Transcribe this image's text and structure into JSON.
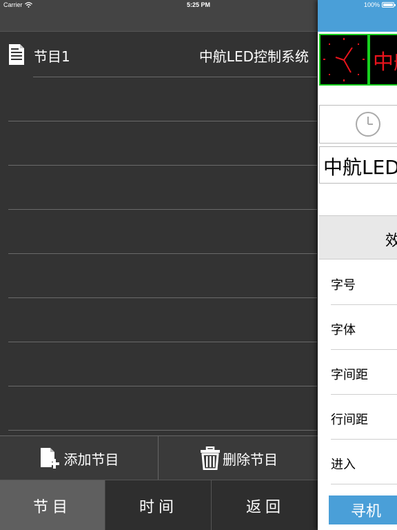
{
  "status_bar": {
    "carrier": "Carrier",
    "time": "5:25 PM",
    "battery": "100%"
  },
  "program_list": {
    "items": [
      {
        "name": "节目1",
        "description": "中航LED控制系统"
      }
    ]
  },
  "actions": {
    "add_label": "添加节目",
    "delete_label": "删除节目"
  },
  "tabs": [
    {
      "label": "节目"
    },
    {
      "label": "时间"
    },
    {
      "label": "返回"
    }
  ],
  "editor": {
    "preview_text": "中航",
    "text_input_value": "中航LED",
    "section_title": "效",
    "properties": [
      {
        "label": "字号"
      },
      {
        "label": "字体"
      },
      {
        "label": "字间距"
      },
      {
        "label": "行间距"
      },
      {
        "label": "进入"
      }
    ],
    "find_button": "寻机"
  },
  "colors": {
    "accent": "#4a9fd8",
    "led_red": "#e8141c",
    "led_green": "#17d11f"
  }
}
